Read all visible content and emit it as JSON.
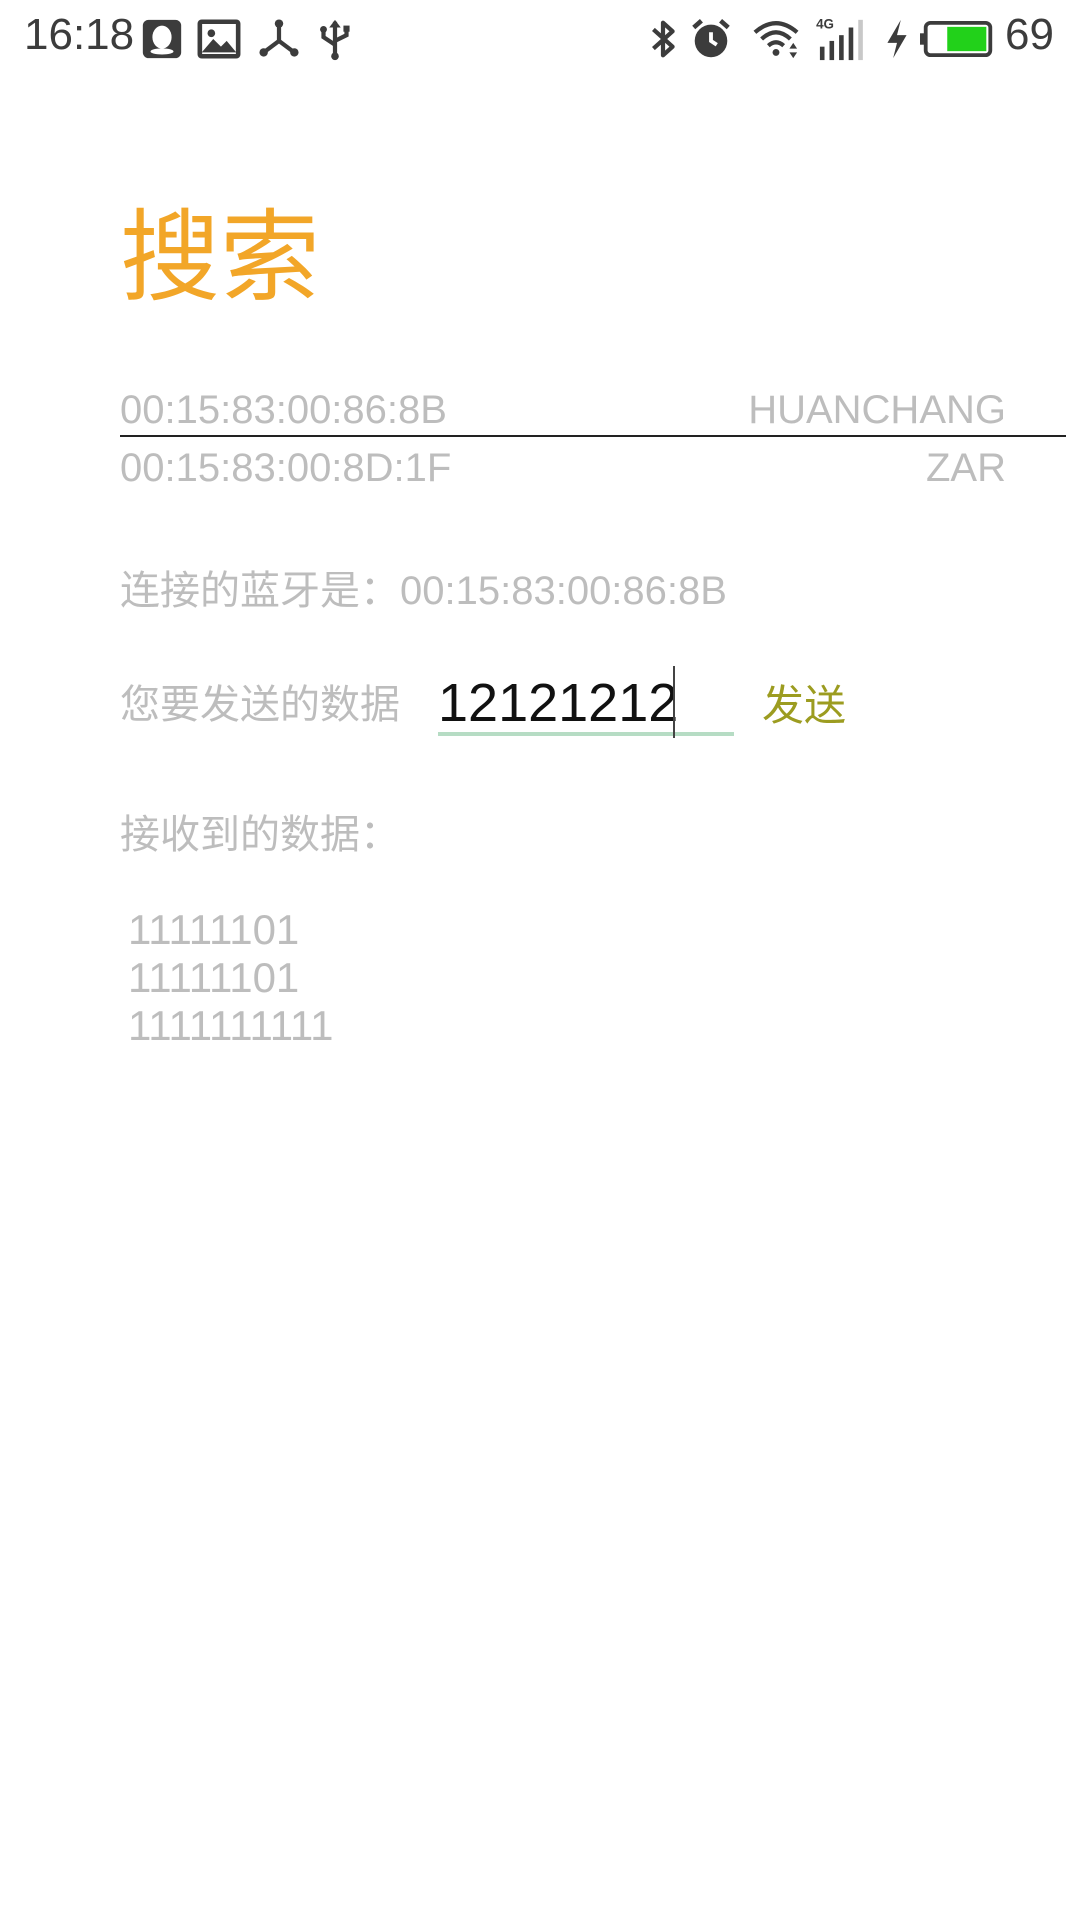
{
  "status_bar": {
    "time": "16:18",
    "left_icons": [
      "qq-icon",
      "gallery-icon",
      "usb-share-icon",
      "usb-icon"
    ],
    "right_icons": [
      "bluetooth-icon",
      "alarm-icon",
      "wifi-icon",
      "4g-signal-icon",
      "charging-icon",
      "battery-icon"
    ],
    "network_label": "4G",
    "battery_percent": "69",
    "battery_color": "#22d11a"
  },
  "search_button": {
    "label": "搜索",
    "color": "#f2a628"
  },
  "devices": [
    {
      "mac": "00:15:83:00:86:8B",
      "name": "HUANCHANG"
    },
    {
      "mac": "00:15:83:00:8D:1F",
      "name": "ZAR"
    }
  ],
  "connected": {
    "label": "连接的蓝牙是：",
    "address": "00:15:83:00:86:8B"
  },
  "send": {
    "label": "您要发送的数据",
    "input_value": "12121212",
    "button_label": "发送",
    "button_color": "#9c9c20"
  },
  "receive": {
    "label": "接收到的数据：",
    "lines": [
      "11111101",
      "11111101",
      "1111111111"
    ]
  }
}
